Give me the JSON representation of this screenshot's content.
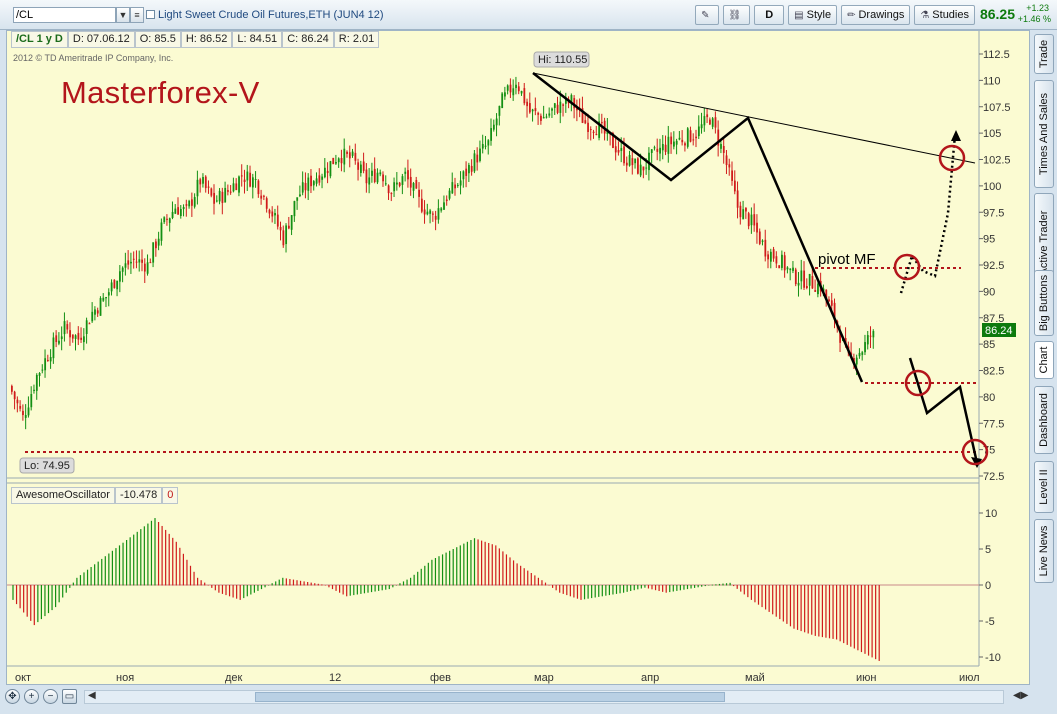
{
  "toolbar": {
    "symbol": "/CL",
    "instrument_title": "Light Sweet Crude Oil Futures,ETH (JUN4 12)",
    "period_button": "D",
    "style_label": "Style",
    "drawings_label": "Drawings",
    "studies_label": "Studies",
    "last_price": "86.25",
    "change_abs": "+1.23",
    "change_pct": "+1.46 %"
  },
  "header": {
    "symbol_period": "/CL 1 y D",
    "date": "D: 07.06.12",
    "open": "O: 85.5",
    "high": "H: 86.52",
    "low": "L: 84.51",
    "close": "C: 86.24",
    "range": "R: 2.01",
    "copyright": "2012 © TD Ameritrade IP Company, Inc."
  },
  "annotations": {
    "watermark": "Masterforex-V",
    "pivot_label": "pivot MF",
    "hi_label": "Hi: 110.55",
    "lo_label": "Lo: 74.95",
    "current_price_tag": "86.24"
  },
  "oscillator": {
    "name": "AwesomeOscillator",
    "value": "-10.478",
    "extra": "0"
  },
  "side_tabs": [
    "Trade",
    "Times And Sales",
    "Active Trader",
    "Big Buttons",
    "Chart",
    "Dashboard",
    "Level II",
    "Live News"
  ],
  "colors": {
    "up": "#138f13",
    "down": "#d01b1b",
    "chart_bg": "#fbfbd2",
    "annotation_red": "#b3151b",
    "price_green": "#0d7a0d"
  },
  "chart_data": [
    {
      "type": "candlestick",
      "title": "Light Sweet Crude Oil Futures,ETH (JUN4 12)",
      "x_tick_labels": [
        "окт",
        "ноя",
        "дек",
        "12",
        "фев",
        "мар",
        "апр",
        "май",
        "июн",
        "июл"
      ],
      "y_tick_labels": [
        "112.5",
        "110",
        "107.5",
        "105",
        "102.5",
        "100",
        "97.5",
        "95",
        "92.5",
        "90",
        "87.5",
        "85",
        "82.5",
        "80",
        "77.5",
        "75",
        "72.5"
      ],
      "ylim": [
        72.5,
        113.5
      ],
      "hi": 110.55,
      "lo": 74.95,
      "last": 86.24,
      "close_path": [
        [
          0,
          80.5
        ],
        [
          4,
          78
        ],
        [
          9,
          82
        ],
        [
          14,
          84.5
        ],
        [
          19,
          86.5
        ],
        [
          24,
          85.5
        ],
        [
          29,
          88
        ],
        [
          34,
          89.5
        ],
        [
          39,
          92
        ],
        [
          44,
          93
        ],
        [
          49,
          92.5
        ],
        [
          54,
          96
        ],
        [
          59,
          98
        ],
        [
          63,
          97.5
        ],
        [
          68,
          100.5
        ],
        [
          73,
          98.5
        ],
        [
          78,
          99.5
        ],
        [
          83,
          101
        ],
        [
          88,
          100.5
        ],
        [
          93,
          98
        ],
        [
          98,
          95
        ],
        [
          103,
          99
        ],
        [
          108,
          100.5
        ],
        [
          113,
          101.5
        ],
        [
          118,
          103
        ],
        [
          123,
          102.5
        ],
        [
          128,
          100.5
        ],
        [
          133,
          101.5
        ],
        [
          137,
          99.5
        ],
        [
          142,
          101
        ],
        [
          147,
          98.5
        ],
        [
          152,
          97
        ],
        [
          157,
          99
        ],
        [
          162,
          100.5
        ],
        [
          167,
          102.5
        ],
        [
          172,
          104
        ],
        [
          177,
          108
        ],
        [
          182,
          110
        ],
        [
          187,
          107
        ],
        [
          192,
          106.5
        ],
        [
          197,
          107.5
        ],
        [
          202,
          108
        ],
        [
          207,
          106
        ],
        [
          212,
          105.5
        ],
        [
          217,
          104
        ],
        [
          222,
          102.5
        ],
        [
          227,
          101.5
        ],
        [
          232,
          103
        ],
        [
          237,
          104
        ],
        [
          242,
          104.5
        ],
        [
          247,
          105
        ],
        [
          252,
          106.5
        ],
        [
          257,
          103
        ],
        [
          262,
          98
        ],
        [
          267,
          96.5
        ],
        [
          272,
          94
        ],
        [
          277,
          93
        ],
        [
          282,
          91.5
        ],
        [
          287,
          91
        ],
        [
          292,
          90.5
        ],
        [
          297,
          87.5
        ],
        [
          302,
          83.5
        ],
        [
          307,
          84.5
        ],
        [
          311,
          86.24
        ]
      ],
      "annotation_levels": {
        "pivot": 92.5,
        "support": 81.5,
        "target": 74.95
      }
    },
    {
      "type": "bar",
      "title": "AwesomeOscillator",
      "y_tick_labels": [
        "10",
        "5",
        "0",
        "-5",
        "-10"
      ],
      "ylim": [
        -10.5,
        11
      ],
      "last": -10.478,
      "profile": [
        [
          0,
          -2
        ],
        [
          6,
          -5.5
        ],
        [
          12,
          -3
        ],
        [
          18,
          1
        ],
        [
          26,
          4
        ],
        [
          34,
          7
        ],
        [
          40,
          9.3
        ],
        [
          46,
          6
        ],
        [
          52,
          1
        ],
        [
          58,
          -1
        ],
        [
          64,
          -2
        ],
        [
          70,
          -0.5
        ],
        [
          76,
          1
        ],
        [
          82,
          0.5
        ],
        [
          88,
          0
        ],
        [
          94,
          -1.5
        ],
        [
          100,
          -1
        ],
        [
          106,
          -0.5
        ],
        [
          112,
          1
        ],
        [
          118,
          3.5
        ],
        [
          124,
          5
        ],
        [
          130,
          6.5
        ],
        [
          136,
          5.5
        ],
        [
          142,
          3
        ],
        [
          148,
          1
        ],
        [
          154,
          -1
        ],
        [
          160,
          -2
        ],
        [
          166,
          -1.5
        ],
        [
          172,
          -1
        ],
        [
          178,
          -0.3
        ],
        [
          184,
          -1
        ],
        [
          190,
          -0.5
        ],
        [
          196,
          0
        ],
        [
          202,
          0.3
        ],
        [
          208,
          -2
        ],
        [
          214,
          -4
        ],
        [
          220,
          -6
        ],
        [
          226,
          -7
        ],
        [
          232,
          -7.5
        ],
        [
          238,
          -9
        ],
        [
          244,
          -10.478
        ]
      ]
    }
  ]
}
